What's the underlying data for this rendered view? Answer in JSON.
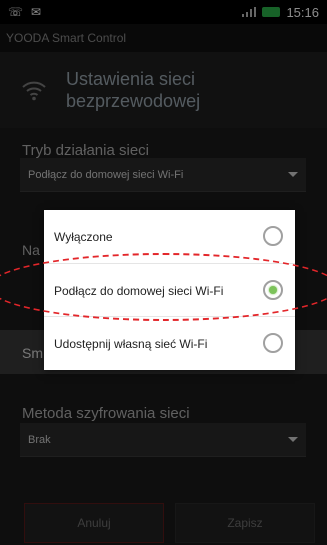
{
  "status_bar": {
    "time": "15:16",
    "left_icons": [
      "whatsapp-icon",
      "notification-icon"
    ],
    "battery_color": "#2bb34a"
  },
  "app": {
    "title": "YOODA Smart Control"
  },
  "header": {
    "title": "Ustawienia sieci bezprzewodowej",
    "icon": "wifi-icon"
  },
  "network_mode": {
    "label": "Tryb działania sieci",
    "selected": "Podłącz do domowej sieci Wi-Fi"
  },
  "partial_labels": {
    "network_name_prefix": "Na",
    "sm_prefix": "Sm"
  },
  "encryption": {
    "label": "Metoda szyfrowania sieci",
    "selected": "Brak"
  },
  "buttons": {
    "cancel": "Anuluj",
    "save": "Zapisz"
  },
  "dialog": {
    "options": [
      {
        "label": "Wyłączone",
        "checked": false
      },
      {
        "label": "Podłącz do domowej sieci Wi-Fi",
        "checked": true
      },
      {
        "label": "Udostępnij własną sieć Wi-Fi",
        "checked": false
      }
    ]
  },
  "colors": {
    "accent_radio": "#7cc35a",
    "highlight": "#e3262a"
  }
}
